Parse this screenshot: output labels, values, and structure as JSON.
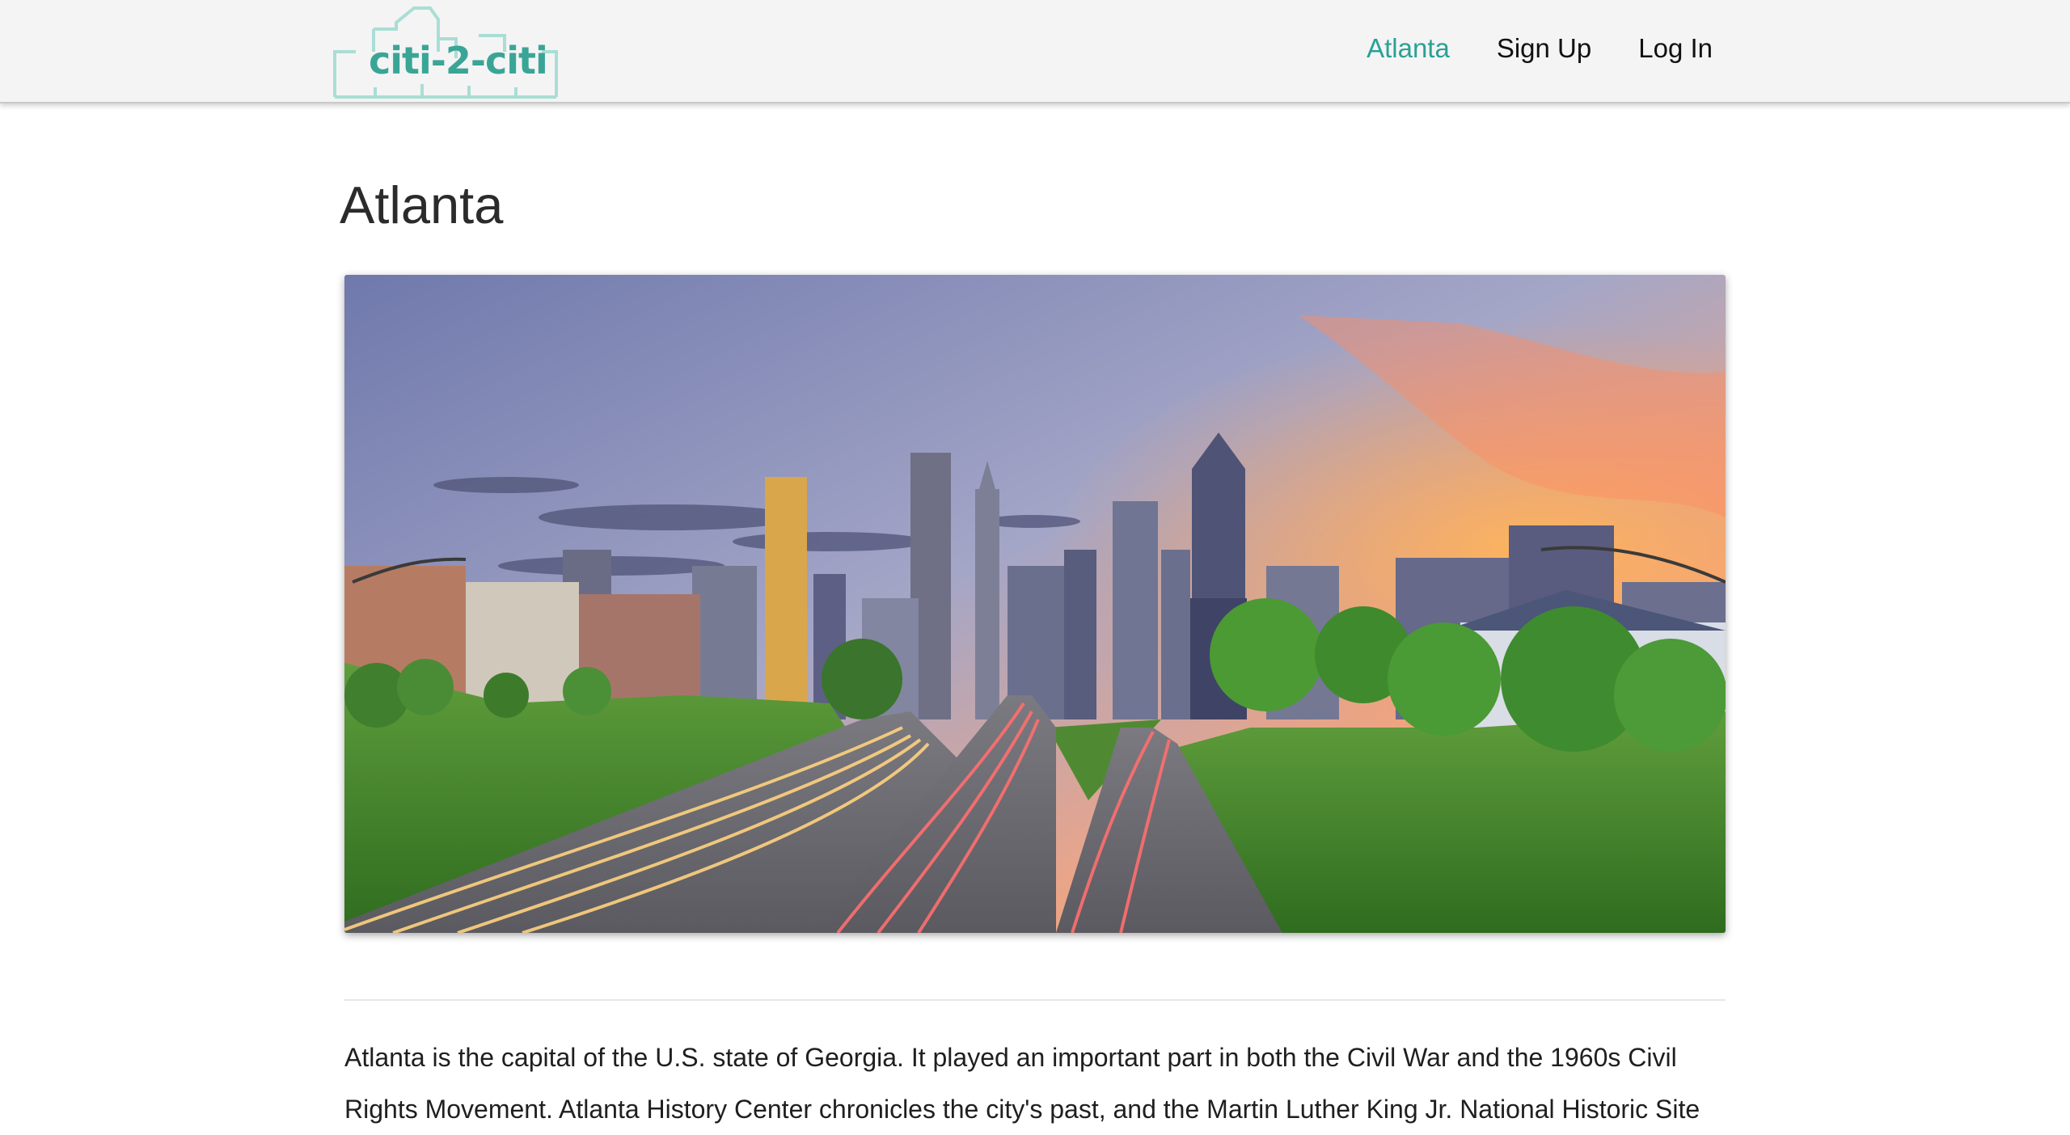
{
  "brand": {
    "logo_text": "citi-2-citi",
    "accent_color": "#2aa195"
  },
  "nav": {
    "items": [
      {
        "label": "Atlanta",
        "active": true
      },
      {
        "label": "Sign Up",
        "active": false
      },
      {
        "label": "Log In",
        "active": false
      }
    ]
  },
  "main": {
    "title": "Atlanta",
    "hero_image": {
      "icon": "atlanta-skyline-highway-photo"
    },
    "description": "Atlanta is the capital of the U.S. state of Georgia. It played an important part in both the Civil War and the 1960s Civil Rights Movement. Atlanta History Center chronicles the city's past, and the Martin Luther King Jr. National Historic Site"
  }
}
